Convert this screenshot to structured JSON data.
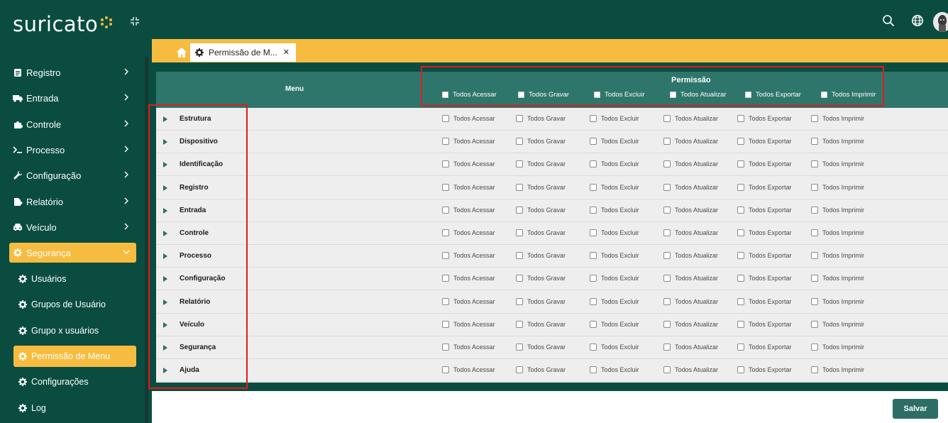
{
  "brand": {
    "name": "suricato"
  },
  "sidebar": {
    "items": [
      {
        "label": "Registro",
        "icon": "clipboard-icon"
      },
      {
        "label": "Entrada",
        "icon": "truck-icon"
      },
      {
        "label": "Controle",
        "icon": "puzzle-icon"
      },
      {
        "label": "Processo",
        "icon": "terminal-icon"
      },
      {
        "label": "Configuração",
        "icon": "wrench-icon"
      },
      {
        "label": "Relatório",
        "icon": "report-icon"
      },
      {
        "label": "Veículo",
        "icon": "car-icon"
      },
      {
        "label": "Segurança",
        "icon": "gear-icon",
        "active": true
      }
    ],
    "subitems": [
      {
        "label": "Usuários"
      },
      {
        "label": "Grupos de Usuário"
      },
      {
        "label": "Grupo x usuários"
      },
      {
        "label": "Permissão de Menu",
        "active": true
      },
      {
        "label": "Configurações"
      },
      {
        "label": "Log"
      }
    ]
  },
  "tab": {
    "label": "Permissão de M..."
  },
  "table": {
    "menu_header": "Menu",
    "permission_header": "Permissão",
    "head_options": [
      "Todos Acessar",
      "Todos Gravar",
      "Todos Excluir",
      "Todos Atualizar",
      "Todos Exportar",
      "Todos Imprimir"
    ],
    "row_options": [
      "Todos Acessar",
      "Todos Gravar",
      "Todos Excluir",
      "Todos Atualizar",
      "Todos Exportar",
      "Todos Imprimir"
    ],
    "rows": [
      "Estrutura",
      "Dispositivo",
      "Identificação",
      "Registro",
      "Entrada",
      "Controle",
      "Processo",
      "Configuração",
      "Relatório",
      "Veículo",
      "Segurança",
      "Ajuda"
    ]
  },
  "actions": {
    "save_label": "Salvar"
  },
  "colors": {
    "primary": "#0a4d40",
    "accent": "#f6bc3f",
    "header": "#2e766c",
    "highlight": "#e21b1b"
  }
}
